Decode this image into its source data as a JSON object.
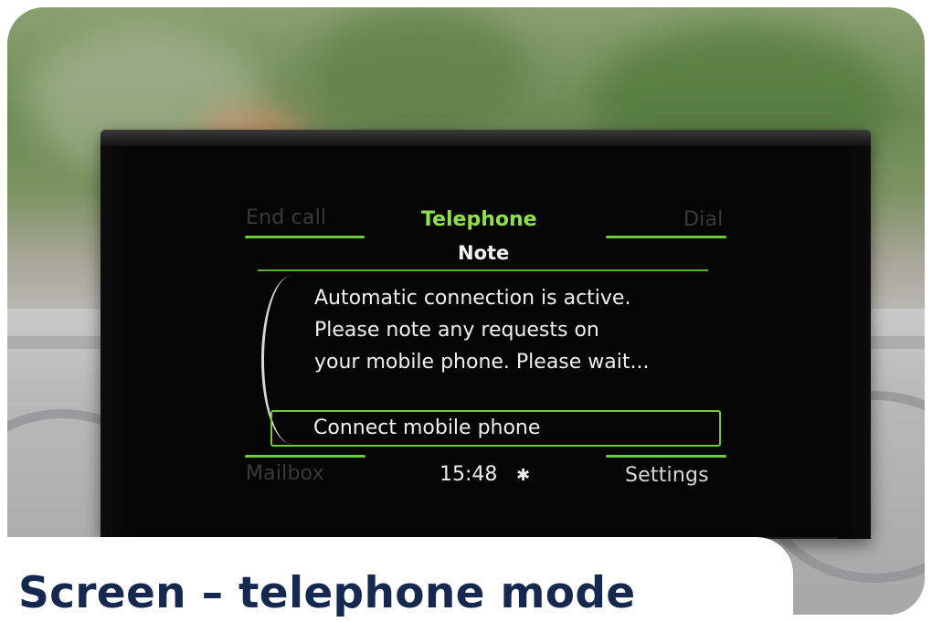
{
  "screen": {
    "left_softkey_top": "End call",
    "title": "Telephone",
    "right_softkey_top": "Dial",
    "note_title": "Note",
    "message_lines": [
      "Automatic connection is active.",
      "Please note any requests on",
      "your mobile phone. Please wait..."
    ],
    "connect_option": "Connect mobile phone",
    "left_softkey_bottom": "Mailbox",
    "clock": "15:48",
    "bluetooth_icon": "bluetooth-icon",
    "right_softkey_bottom": "Settings"
  },
  "caption": "Screen – telephone mode",
  "colors": {
    "accent_green": "#6ecb3a",
    "caption_navy": "#142850"
  }
}
